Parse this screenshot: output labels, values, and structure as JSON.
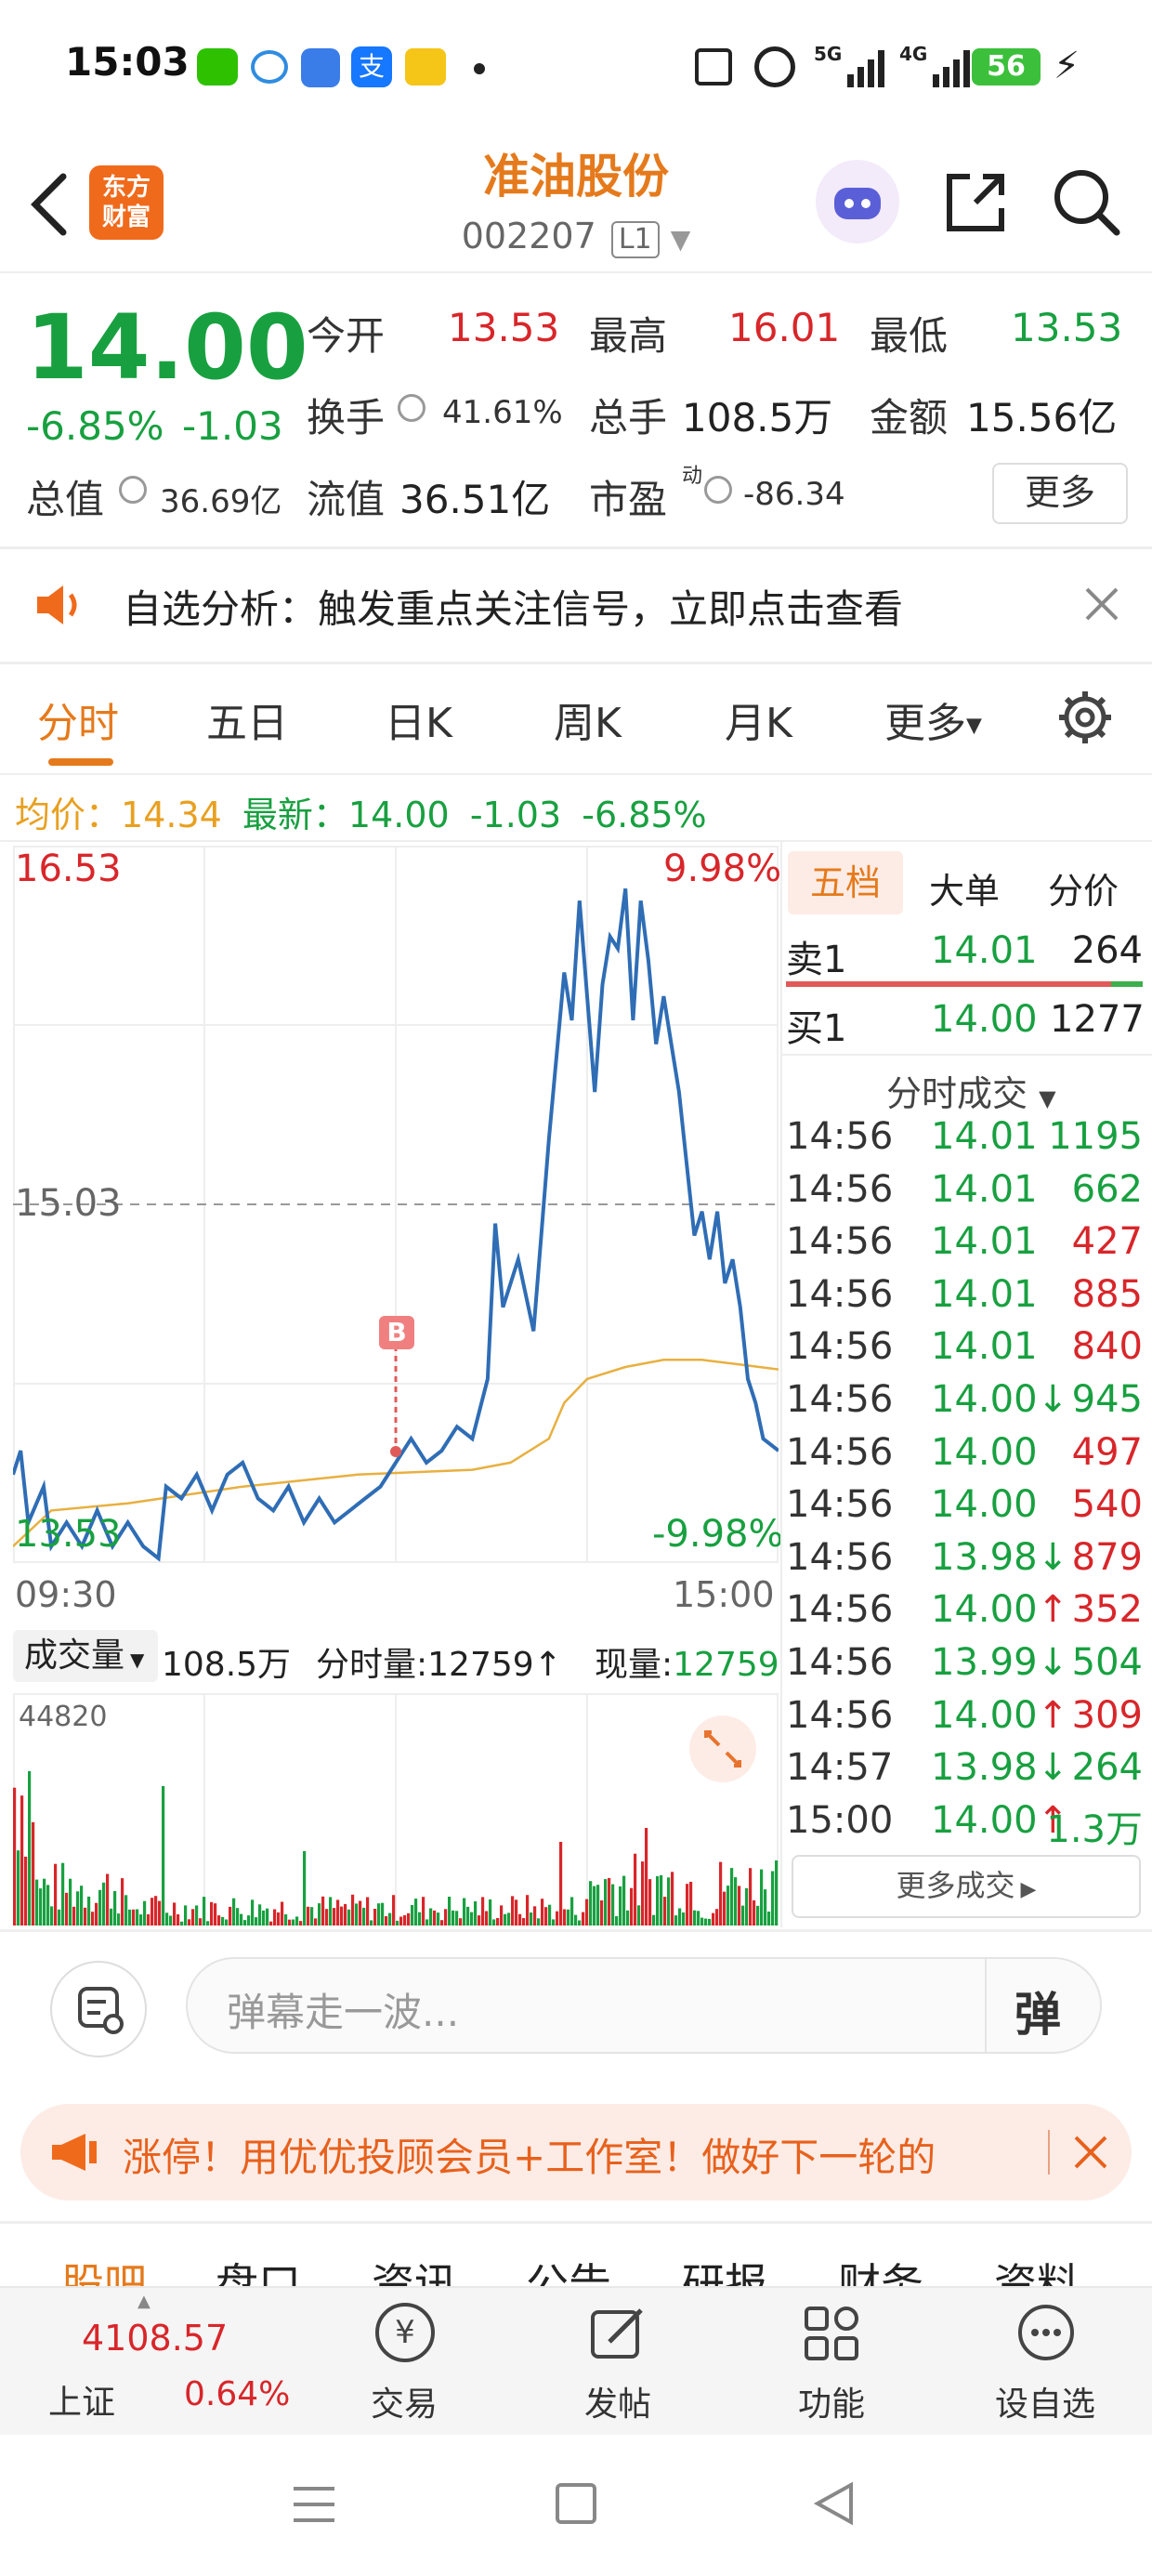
{
  "status_bar": {
    "time": "15:03",
    "network": "5G",
    "network2": "4G",
    "battery": "56"
  },
  "header": {
    "title": "准油股份",
    "code": "002207",
    "level_badge": "L1",
    "logo_line1": "东方",
    "logo_line2": "财富"
  },
  "quote": {
    "price": "14.00",
    "change_pct": "-6.85%",
    "change_abs": "-1.03",
    "open_label": "今开",
    "open_value": "13.53",
    "high_label": "最高",
    "high_value": "16.01",
    "low_label": "最低",
    "low_value": "13.53",
    "turnover_label": "换手",
    "turnover_value": "41.61%",
    "volume_label": "总手",
    "volume_value": "108.5万",
    "amount_label": "金额",
    "amount_value": "15.56亿",
    "mktcap_label": "总值",
    "mktcap_value": "36.69亿",
    "float_label": "流值",
    "float_value": "36.51亿",
    "pe_label": "市盈",
    "pe_sup": "动",
    "pe_value": "-86.34",
    "more": "更多"
  },
  "notice": {
    "text": "自选分析：触发重点关注信号，立即点击查看"
  },
  "tabs": [
    "分时",
    "五日",
    "日K",
    "周K",
    "月K",
    "更多"
  ],
  "intraday_header": {
    "avg_label": "均价：",
    "avg_value": "14.34",
    "latest_label": "最新：",
    "latest_value": "14.00",
    "latest_change": "-1.03",
    "latest_pct": "-6.85%"
  },
  "chart_labels": {
    "top_price": "16.53",
    "mid_price": "15.03",
    "bottom_price": "13.53",
    "top_pct": "9.98%",
    "bottom_pct": "-9.98%",
    "start_time": "09:30",
    "end_time": "15:00",
    "marker": "B"
  },
  "volume_bar": {
    "label": "成交量",
    "total": "108.5万",
    "minute_label": "分时量:12759",
    "current_label": "现量:",
    "current_value": "12759",
    "max": "44820"
  },
  "order_book": {
    "tabs": [
      "五档",
      "大单",
      "分价"
    ],
    "sell1_label": "卖1",
    "sell1_price": "14.01",
    "sell1_vol": "264",
    "buy1_label": "买1",
    "buy1_price": "14.00",
    "buy1_vol": "1277",
    "trades_title": "分时成交",
    "more_trades": "更多成交"
  },
  "trades": [
    {
      "time": "14:56",
      "price": "14.01",
      "vol": "1195",
      "color": "green",
      "arrow": ""
    },
    {
      "time": "14:56",
      "price": "14.01",
      "vol": "662",
      "color": "green",
      "arrow": ""
    },
    {
      "time": "14:56",
      "price": "14.01",
      "vol": "427",
      "color": "red",
      "arrow": ""
    },
    {
      "time": "14:56",
      "price": "14.01",
      "vol": "885",
      "color": "red",
      "arrow": ""
    },
    {
      "time": "14:56",
      "price": "14.01",
      "vol": "840",
      "color": "red",
      "arrow": ""
    },
    {
      "time": "14:56",
      "price": "14.00",
      "vol": "945",
      "color": "green",
      "arrow": "↓"
    },
    {
      "time": "14:56",
      "price": "14.00",
      "vol": "497",
      "color": "red",
      "arrow": ""
    },
    {
      "time": "14:56",
      "price": "14.00",
      "vol": "540",
      "color": "red",
      "arrow": ""
    },
    {
      "time": "14:56",
      "price": "13.98",
      "vol": "879",
      "color": "red",
      "arrow": "↓"
    },
    {
      "time": "14:56",
      "price": "14.00",
      "vol": "352",
      "color": "red",
      "arrow": "↑"
    },
    {
      "time": "14:56",
      "price": "13.99",
      "vol": "504",
      "color": "green",
      "arrow": "↓"
    },
    {
      "time": "14:56",
      "price": "14.00",
      "vol": "309",
      "color": "red",
      "arrow": "↑"
    },
    {
      "time": "14:57",
      "price": "13.98",
      "vol": "264",
      "color": "green",
      "arrow": "↓"
    },
    {
      "time": "15:00",
      "price": "14.00",
      "vol": "1.3万",
      "color": "green",
      "arrow": "↑"
    }
  ],
  "danmaku": {
    "placeholder": "弹幕走一波...",
    "send": "弹"
  },
  "promo": {
    "text": "涨停！用优优投顾会员+工作室！做好下一轮的"
  },
  "sub_tabs": [
    "股吧",
    "盘口",
    "资讯",
    "公告",
    "研报",
    "财务",
    "资料"
  ],
  "bottom_bar": {
    "index_value": "4108.57",
    "index_name": "上证",
    "index_pct": "0.64%",
    "items": [
      "交易",
      "发帖",
      "功能",
      "设自选"
    ]
  },
  "colors": {
    "accent": "#e57a1c",
    "up": "#d8262a",
    "down": "#18a040",
    "price_line": "#2f6db5",
    "avg_line": "#e8b040"
  }
}
